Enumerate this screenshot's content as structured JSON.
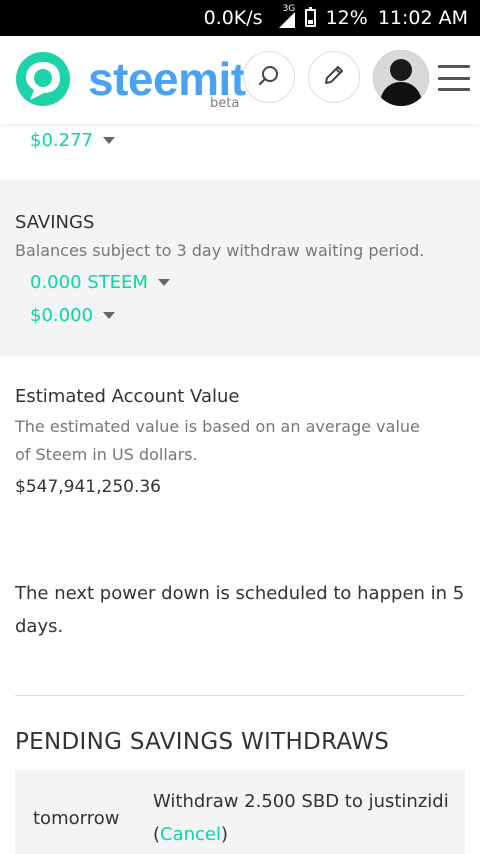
{
  "status_bar": {
    "speed": "0.0K/s",
    "network": "3G",
    "battery": "12%",
    "time": "11:02 AM"
  },
  "header": {
    "brand": "steemit",
    "beta": "beta",
    "icons": [
      "steemit-logo-icon",
      "search-icon",
      "pencil-icon",
      "avatar",
      "hamburger-menu-icon"
    ]
  },
  "top_amount": "$0.277",
  "savings": {
    "title": "SAVINGS",
    "description": "Balances subject to 3 day withdraw waiting period.",
    "steem": "0.000 STEEM",
    "usd": "$0.000"
  },
  "estimated": {
    "title": "Estimated Account Value",
    "description": "The estimated value is based on an average value of Steem in US dollars.",
    "value": "$547,941,250.36"
  },
  "power_down": "The next power down is scheduled to happen  in 5 days.",
  "pending": {
    "title": "PENDING SAVINGS WITHDRAWS",
    "when": "tomorrow",
    "text": "Withdraw 2.500 SBD to justinzidi (",
    "cancel": "Cancel",
    "close": ")"
  },
  "colors": {
    "accent": "#06d6a9",
    "brand": "#4ba2f2",
    "savings_bg": "#f4f4f4"
  }
}
